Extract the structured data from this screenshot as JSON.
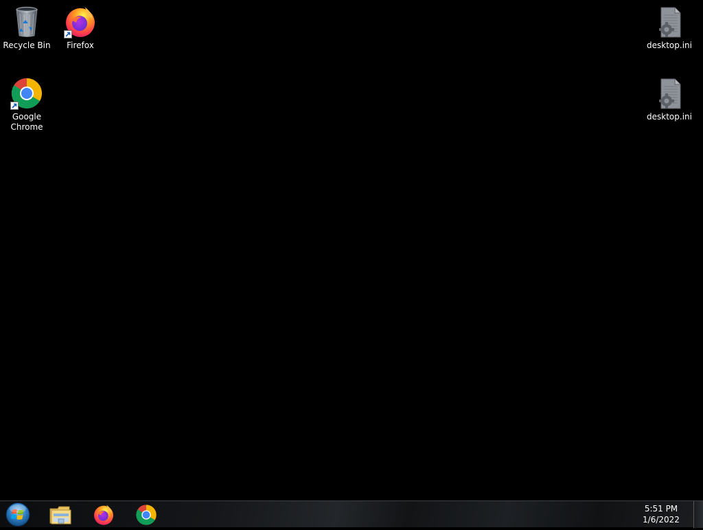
{
  "desktop": {
    "background": "#000000",
    "icons": [
      {
        "label": "Recycle Bin",
        "icon": "recycle-bin-icon"
      },
      {
        "label": "Firefox",
        "icon": "firefox-icon"
      },
      {
        "label": "Google Chrome",
        "icon": "chrome-icon"
      },
      {
        "label": "desktop.ini",
        "icon": "config-file-icon"
      },
      {
        "label": "desktop.ini",
        "icon": "config-file-icon"
      }
    ]
  },
  "taskbar": {
    "start_icon": "windows-start-orb-icon",
    "pinned": [
      {
        "icon": "file-explorer-icon"
      },
      {
        "icon": "firefox-icon"
      },
      {
        "icon": "chrome-icon"
      }
    ],
    "clock": {
      "time": "5:51 PM",
      "date": "1/6/2022"
    }
  }
}
